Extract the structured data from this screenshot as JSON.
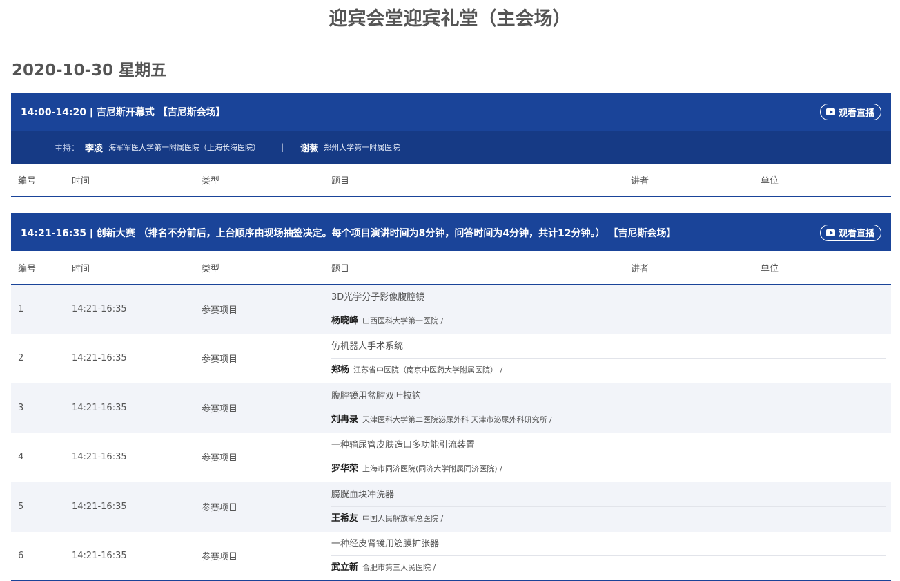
{
  "page": {
    "title": "迎宾会堂迎宾礼堂（主会场）",
    "date": "2020-10-30 星期五"
  },
  "live_label": "观看直播",
  "columns": [
    "编号",
    "时间",
    "类型",
    "题目",
    "讲者",
    "单位"
  ],
  "session1": {
    "title": "14:00-14:20 | 吉尼斯开幕式 【吉尼斯会场】",
    "host_label": "主持：",
    "hosts": [
      {
        "name": "李凌",
        "org": "海军军医大学第一附属医院（上海长海医院）"
      },
      {
        "name": "谢薇",
        "org": "郑州大学第一附属医院"
      }
    ],
    "host_separator": "|"
  },
  "session2": {
    "title": "14:21-16:35 | 创新大赛 （排名不分前后，上台顺序由现场抽签决定。每个项目演讲时间为8分钟，问答时间为4分钟，共计12分钟。） 【吉尼斯会场】",
    "rows": [
      {
        "num": "1",
        "time": "14:21-16:35",
        "type": "参赛项目",
        "topic": "3D光学分子影像腹腔镜",
        "speaker": "杨晓峰",
        "org": "山西医科大学第一医院 /"
      },
      {
        "num": "2",
        "time": "14:21-16:35",
        "type": "参赛项目",
        "topic": "仿机器人手术系统",
        "speaker": "郑杨",
        "org": "江苏省中医院（南京中医药大学附属医院） /"
      },
      {
        "num": "3",
        "time": "14:21-16:35",
        "type": "参赛项目",
        "topic": "腹腔镜用盆腔双叶拉钩",
        "speaker": "刘冉录",
        "org": "天津医科大学第二医院泌尿外科 天津市泌尿外科研究所 /"
      },
      {
        "num": "4",
        "time": "14:21-16:35",
        "type": "参赛项目",
        "topic": "一种输尿管皮肤造口多功能引流装置",
        "speaker": "罗华荣",
        "org": "上海市同济医院(同济大学附属同济医院) /"
      },
      {
        "num": "5",
        "time": "14:21-16:35",
        "type": "参赛项目",
        "topic": "膀胱血块冲洗器",
        "speaker": "王希友",
        "org": "中国人民解放军总医院 /"
      },
      {
        "num": "6",
        "time": "14:21-16:35",
        "type": "参赛项目",
        "topic": "一种经皮肾镜用筋膜扩张器",
        "speaker": "武立新",
        "org": "合肥市第三人民医院 /"
      }
    ]
  }
}
